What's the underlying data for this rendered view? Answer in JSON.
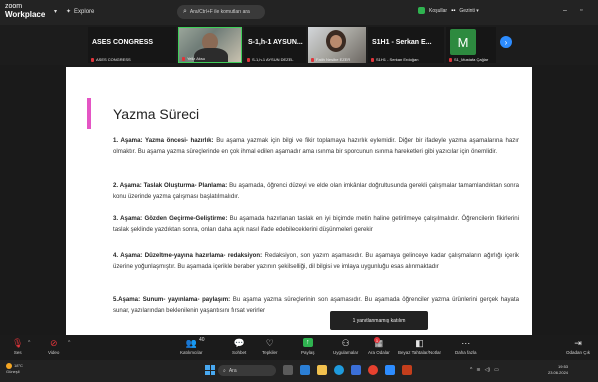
{
  "topbar": {
    "logo_line1": "zoom",
    "logo_line2": "Workplace",
    "explore_label": "Explore",
    "search_text": "Ara/Ctrl+F ile komutları ara",
    "status_text": "Koşullar",
    "user_label": "Gezinti ▾",
    "min": "–",
    "close": "□"
  },
  "videos": [
    {
      "name": "ASES CONGRESS",
      "caption": "ASES CONGRESS"
    },
    {
      "name": "",
      "caption": "Yeliz Aksu"
    },
    {
      "name": "S-1,h-1 AYSUN...",
      "caption": "S-1,h-1 AYSUN DEZEL"
    },
    {
      "name": "",
      "caption": "Fatih Nesibe EZER"
    },
    {
      "name": "S1H1 - Serkan E...",
      "caption": "S1H1 - Serkan Erdoğan"
    },
    {
      "name": "M",
      "caption": "S1_Mustafa Çağlar"
    }
  ],
  "slide": {
    "title": "Yazma Süreci",
    "items": [
      {
        "head": "1. Aşama: Yazma öncesi- hazırlık:",
        "text": " Bu aşama yazmak için bilgi ve fikir toplamaya hazırlık eylemidir. Diğer bir ifadeyle yazma aşamalarına hazır olmaktır. Bu aşama yazma süreçlerinde en çok ihmal edilen aşamadır ama ısınma bir sporcunun ısınma hareketleri gibi yazıcılar için önemlidir."
      },
      {
        "head": "2. Aşama: Taslak Oluşturma- Planlama:",
        "text": " Bu aşamada, öğrenci düzeyi ve elde olan imkânlar doğrultusunda gerekli çalışmalar tamamlandıktan sonra konu üzerinde yazma çalışması başlatılmalıdır."
      },
      {
        "head": "3. Aşama: Gözden Geçirme-Geliştirme:",
        "text": " Bu aşamada hazırlanan taslak en iyi biçimde metin haline getirilmeye çalışılmalıdır. Öğrencilerin fikirlerini taslak şeklinde yazdıktan sonra, onları daha açık nasıl ifade edebileceklerini düşünmeleri gerekir"
      },
      {
        "head": "4. Aşama: Düzeltme-yayına hazırlama- redaksiyon:",
        "text": " Redaksiyon, son yazım aşamasıdır. Bu aşamaya gelinceye kadar çalışmaların ağırlığı içerik üzerine yoğunlaşmıştır. Bu aşamada içerikle beraber yazının şekilselliği, dil bilgisi ve imlaya uygunluğu esas alınmaktadır"
      },
      {
        "head": "5.Aşama: Sunum- yayınlama- paylaşım:",
        "text": " Bu aşama yazma süreçlerinin son aşamasıdır. Bu aşamada öğrenciler yazma ürünlerini gerçek hayata sunar, yazılarından beklenilenin yaşantısını fırsat verirler"
      }
    ]
  },
  "tooltip": "1 yanıtlanmamış katılım",
  "toolbar": {
    "audio": "Ses",
    "video": "Video",
    "participants": "Katılımcılar",
    "participants_count": "40",
    "chat": "Sohbet",
    "reactions": "Tepkiler",
    "share": "Paylaş",
    "apps": "Uygulamalar",
    "rooms": "Ara Odalar",
    "rooms_badge": "1",
    "whiteboards": "Beyaz Tahtalar/Notlar",
    "more": "Daha fazla",
    "leave": "Odadan Çık"
  },
  "taskbar": {
    "temp": "18°C",
    "weather": "Güneşli",
    "search": "Ara",
    "time": "19:53",
    "date": "23.06.2024"
  }
}
